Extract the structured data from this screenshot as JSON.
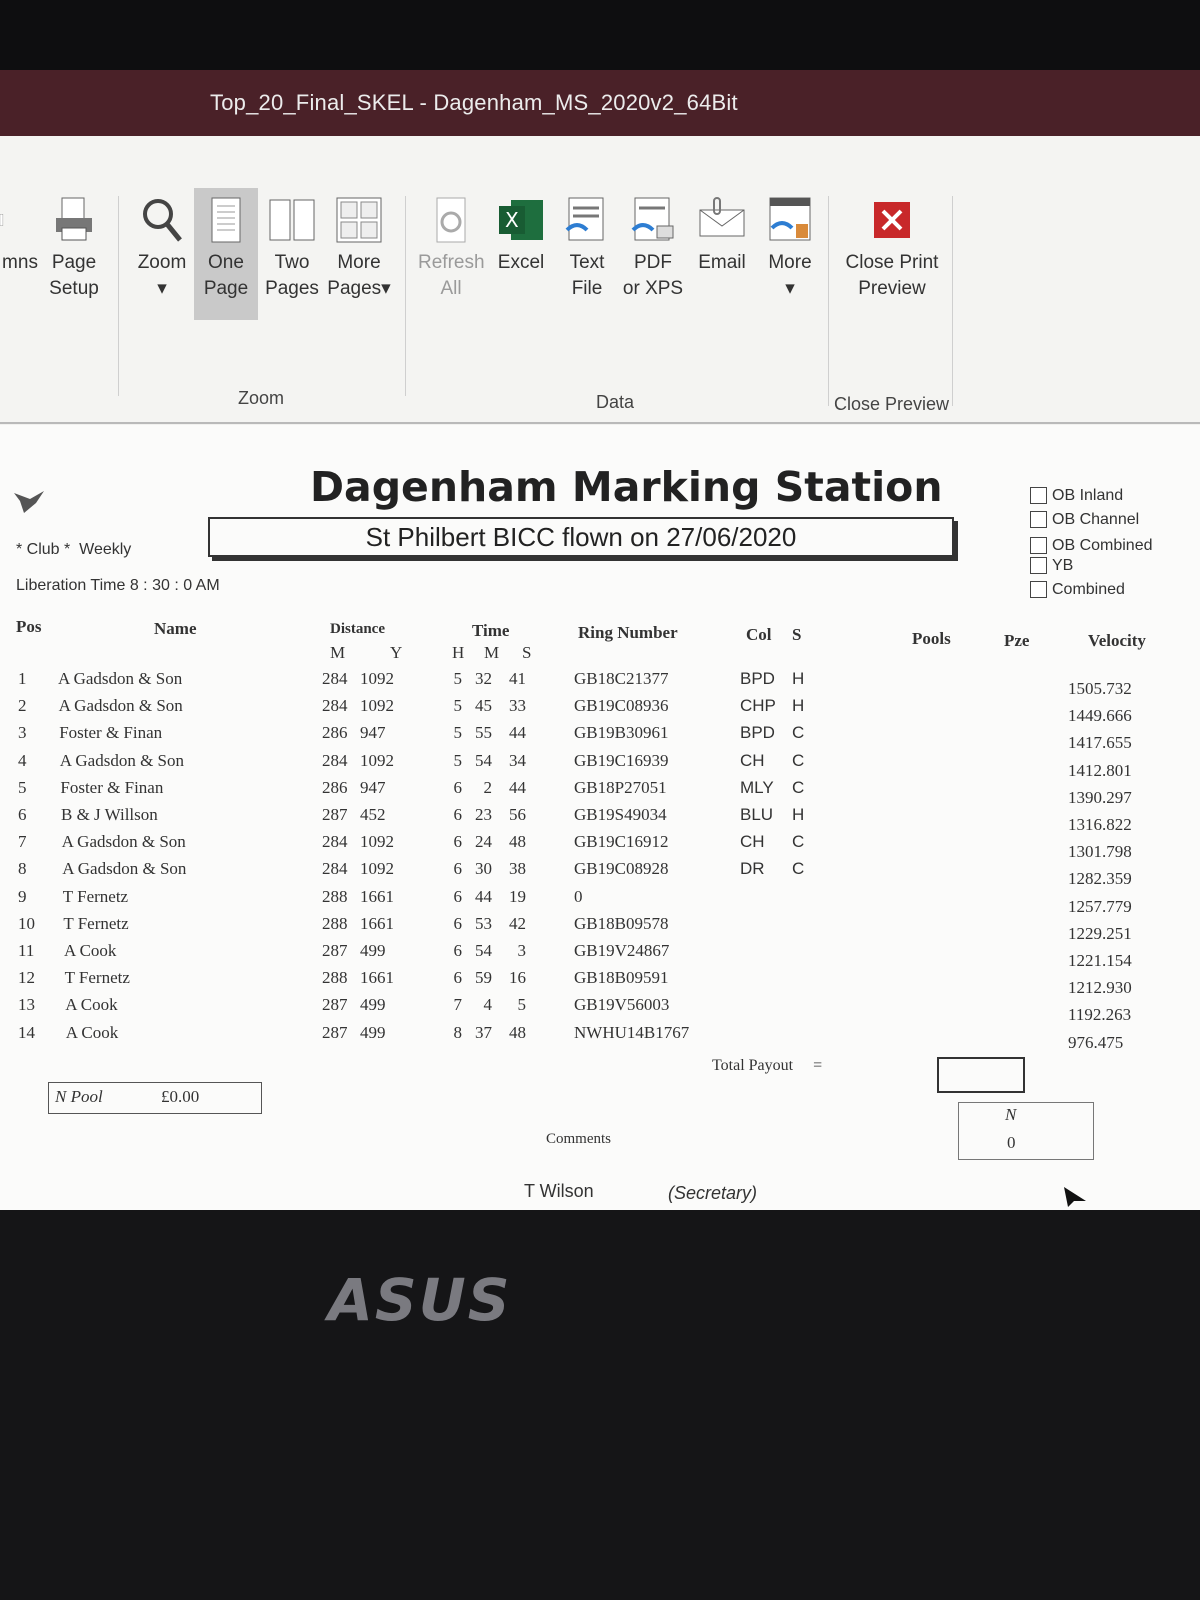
{
  "window": {
    "title": "Top_20_Final_SKEL  -  Dagenham_MS_2020v2_64Bit"
  },
  "ribbon": {
    "columns_label": "mns",
    "page_setup": [
      "Page",
      "Setup"
    ],
    "zoom": "Zoom",
    "one_page": [
      "One",
      "Page"
    ],
    "two_pages": [
      "Two",
      "Pages"
    ],
    "more_pages": [
      "More",
      "Pages"
    ],
    "group_zoom": "Zoom",
    "refresh_all": [
      "Refresh",
      "All"
    ],
    "excel": "Excel",
    "text_file": [
      "Text",
      "File"
    ],
    "pdf_xps": [
      "PDF",
      "or XPS"
    ],
    "email": "Email",
    "more": "More",
    "group_data": "Data",
    "close_print_preview": [
      "Close Print",
      "Preview"
    ],
    "group_close_preview": "Close Preview"
  },
  "report": {
    "title": "Dagenham Marking Station",
    "subtitle": "St Philbert BICC flown on 27/06/2020",
    "club": "* Club *",
    "frequency": "Weekly",
    "liberation": "Liberation Time  8 : 30 : 0 AM",
    "checkboxes": [
      "OB Inland",
      "OB Channel",
      "OB Combined",
      "YB",
      "Combined"
    ],
    "headers": {
      "pos": "Pos",
      "name": "Name",
      "distance": "Distance",
      "dist_m": "M",
      "dist_y": "Y",
      "time": "Time",
      "time_h": "H",
      "time_m": "M",
      "time_s": "S",
      "ring": "Ring Number",
      "col": "Col",
      "sex": "S",
      "pools": "Pools",
      "pze": "Pze",
      "velocity": "Velocity"
    },
    "rows": [
      {
        "pos": "1",
        "name": "A Gadsdon & Son",
        "m": "284",
        "y": "1092",
        "h": "5",
        "mi": "32",
        "s": "41",
        "ring": "GB18C21377",
        "col": "BPD",
        "sex": "H",
        "vel": "1505.732"
      },
      {
        "pos": "2",
        "name": "A Gadsdon & Son",
        "m": "284",
        "y": "1092",
        "h": "5",
        "mi": "45",
        "s": "33",
        "ring": "GB19C08936",
        "col": "CHP",
        "sex": "H",
        "vel": "1449.666"
      },
      {
        "pos": "3",
        "name": "Foster & Finan",
        "m": "286",
        "y": "947",
        "h": "5",
        "mi": "55",
        "s": "44",
        "ring": "GB19B30961",
        "col": "BPD",
        "sex": "C",
        "vel": "1417.655"
      },
      {
        "pos": "4",
        "name": "A Gadsdon & Son",
        "m": "284",
        "y": "1092",
        "h": "5",
        "mi": "54",
        "s": "34",
        "ring": "GB19C16939",
        "col": "CH",
        "sex": "C",
        "vel": "1412.801"
      },
      {
        "pos": "5",
        "name": "Foster & Finan",
        "m": "286",
        "y": "947",
        "h": "6",
        "mi": "2",
        "s": "44",
        "ring": "GB18P27051",
        "col": "MLY",
        "sex": "C",
        "vel": "1390.297"
      },
      {
        "pos": "6",
        "name": "B & J Willson",
        "m": "287",
        "y": "452",
        "h": "6",
        "mi": "23",
        "s": "56",
        "ring": "GB19S49034",
        "col": "BLU",
        "sex": "H",
        "vel": "1316.822"
      },
      {
        "pos": "7",
        "name": "A Gadsdon & Son",
        "m": "284",
        "y": "1092",
        "h": "6",
        "mi": "24",
        "s": "48",
        "ring": "GB19C16912",
        "col": "CH",
        "sex": "C",
        "vel": "1301.798"
      },
      {
        "pos": "8",
        "name": "A Gadsdon & Son",
        "m": "284",
        "y": "1092",
        "h": "6",
        "mi": "30",
        "s": "38",
        "ring": "GB19C08928",
        "col": "DR",
        "sex": "C",
        "vel": "1282.359"
      },
      {
        "pos": "9",
        "name": "T Fernetz",
        "m": "288",
        "y": "1661",
        "h": "6",
        "mi": "44",
        "s": "19",
        "ring": "0",
        "col": "",
        "sex": "",
        "vel": "1257.779"
      },
      {
        "pos": "10",
        "name": "T Fernetz",
        "m": "288",
        "y": "1661",
        "h": "6",
        "mi": "53",
        "s": "42",
        "ring": "GB18B09578",
        "col": "",
        "sex": "",
        "vel": "1229.251"
      },
      {
        "pos": "11",
        "name": "A Cook",
        "m": "287",
        "y": "499",
        "h": "6",
        "mi": "54",
        "s": "3",
        "ring": "GB19V24867",
        "col": "",
        "sex": "",
        "vel": "1221.154"
      },
      {
        "pos": "12",
        "name": "T Fernetz",
        "m": "288",
        "y": "1661",
        "h": "6",
        "mi": "59",
        "s": "16",
        "ring": "GB18B09591",
        "col": "",
        "sex": "",
        "vel": "1212.930"
      },
      {
        "pos": "13",
        "name": "A Cook",
        "m": "287",
        "y": "499",
        "h": "7",
        "mi": "4",
        "s": "5",
        "ring": "GB19V56003",
        "col": "",
        "sex": "",
        "vel": "1192.263"
      },
      {
        "pos": "14",
        "name": "A Cook",
        "m": "287",
        "y": "499",
        "h": "8",
        "mi": "37",
        "s": "48",
        "ring": "NWHU14B1767",
        "col": "",
        "sex": "",
        "vel": "976.475"
      }
    ],
    "total_payout": "Total Payout",
    "equals": "=",
    "n_pool": "N  Pool",
    "n_pool_value": "£0.00",
    "n_label": "N",
    "n_value": "0",
    "comments": "Comments",
    "signatory": "T Wilson",
    "signatory_role": "(Secretary)"
  },
  "laptop": {
    "brand": "ASUS"
  }
}
